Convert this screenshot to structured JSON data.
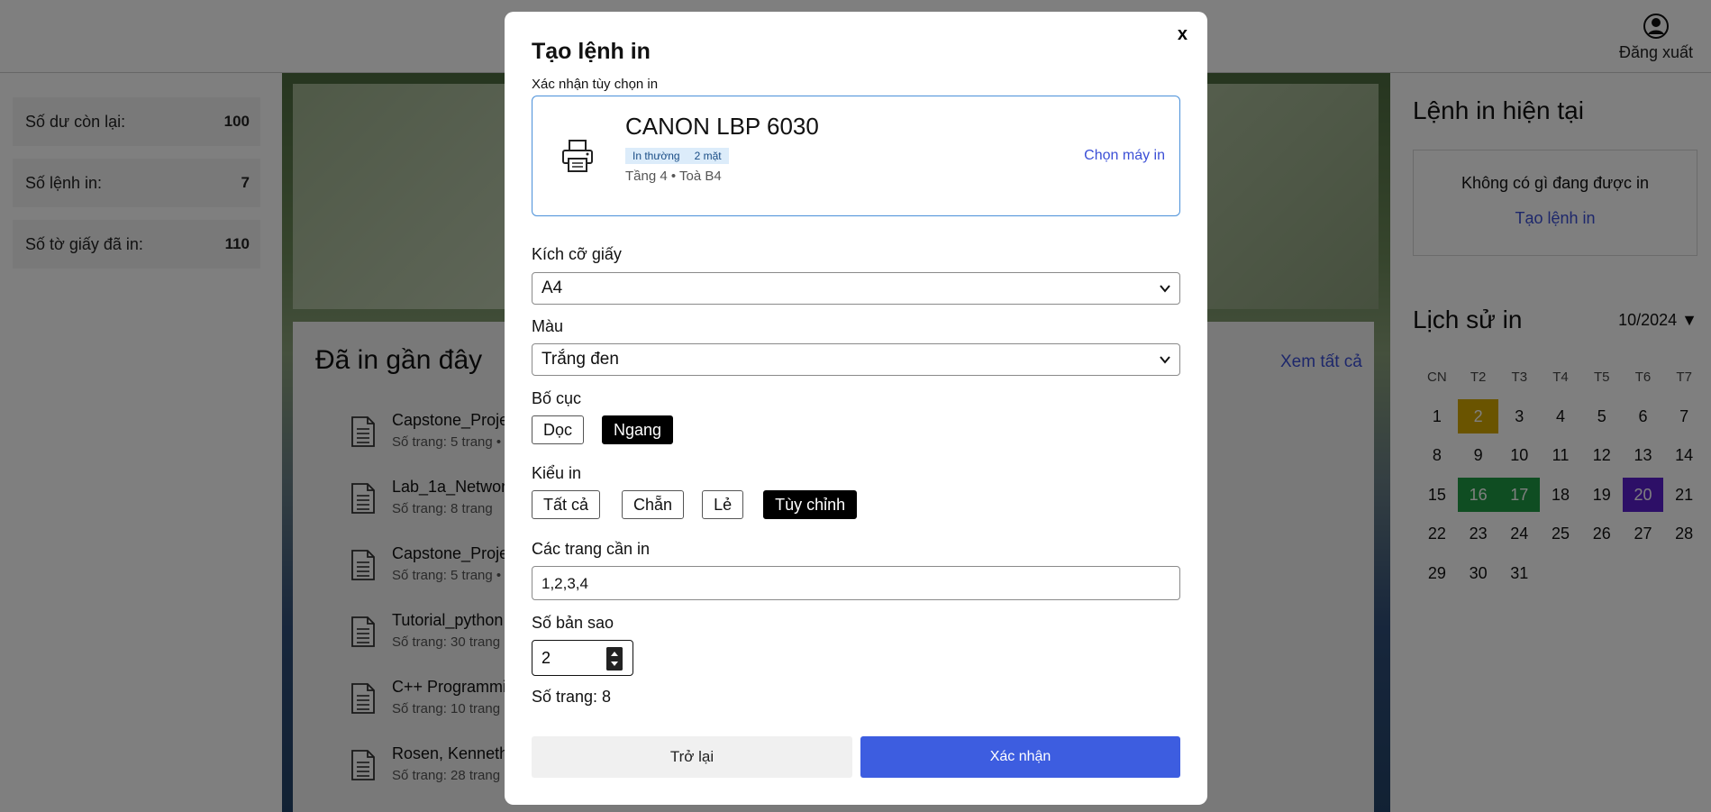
{
  "header": {
    "logout_label": "Đăng xuất"
  },
  "stats": [
    {
      "label": "Số dư còn lại:",
      "value": "100"
    },
    {
      "label": "Số lệnh in:",
      "value": "7"
    },
    {
      "label": "Số tờ giấy đã in:",
      "value": "110"
    }
  ],
  "recent": {
    "title": "Đã in gần đây",
    "see_all": "Xem tất cả",
    "items": [
      {
        "name": "Capstone_Proje",
        "meta": "Số trang: 5 trang •"
      },
      {
        "name": "Lab_1a_Networ",
        "meta": "Số trang: 8 trang"
      },
      {
        "name": "Capstone_Proje",
        "meta": "Số trang: 5 trang •"
      },
      {
        "name": "Tutorial_python.",
        "meta": "Số trang: 30 trang"
      },
      {
        "name": "C++ Programmi",
        "meta": "Số trang: 10 trang"
      },
      {
        "name": "Rosen, Kenneth",
        "meta": "Số trang: 28 trang"
      }
    ]
  },
  "current": {
    "title": "Lệnh in hiện tại",
    "empty_text": "Không có gì đang được in",
    "create_link": "Tạo lệnh in"
  },
  "history": {
    "title": "Lịch sử in",
    "month": "10/2024 ▼",
    "weekdays": [
      "CN",
      "T2",
      "T3",
      "T4",
      "T5",
      "T6",
      "T7"
    ],
    "weeks": [
      [
        "1",
        "2",
        "3",
        "4",
        "5",
        "6",
        "7"
      ],
      [
        "8",
        "9",
        "10",
        "11",
        "12",
        "13",
        "14"
      ],
      [
        "15",
        "16",
        "17",
        "18",
        "19",
        "20",
        "21"
      ],
      [
        "22",
        "23",
        "24",
        "25",
        "26",
        "27",
        "28"
      ],
      [
        "29",
        "30",
        "31",
        "",
        "",
        "",
        ""
      ]
    ],
    "highlight_colors": {
      "2": "#d4a900",
      "16": "#1f9a44",
      "17": "#1f9a44",
      "20": "#5a1fcf"
    }
  },
  "modal": {
    "title": "Tạo lệnh in",
    "close": "x",
    "subtitle": "Xác nhận tùy chọn in",
    "printer": {
      "name": "CANON LBP 6030",
      "tags": [
        "In thường",
        "2 mặt"
      ],
      "location": "Tầng 4 • Toà B4",
      "choose_label": "Chọn máy in"
    },
    "paper_size": {
      "label": "Kích cỡ giấy",
      "value": "A4"
    },
    "color": {
      "label": "Màu",
      "value": "Trắng đen"
    },
    "layout": {
      "label": "Bố cục",
      "options": [
        "Dọc",
        "Ngang"
      ],
      "selected": "Ngang"
    },
    "print_type": {
      "label": "Kiểu in",
      "options": [
        "Tất cả",
        "Chẵn",
        "Lẻ",
        "Tùy chỉnh"
      ],
      "selected": "Tùy chỉnh"
    },
    "pages": {
      "label": "Các trang cần in",
      "value": "1,2,3,4"
    },
    "copies": {
      "label": "Số bản sao",
      "value": "2"
    },
    "page_count": "Số trang: 8",
    "back_label": "Trở lại",
    "confirm_label": "Xác nhận"
  },
  "colors": {
    "accent": "#3d5de0",
    "link": "#3b4fd6",
    "printer_border": "#4a90d9"
  }
}
